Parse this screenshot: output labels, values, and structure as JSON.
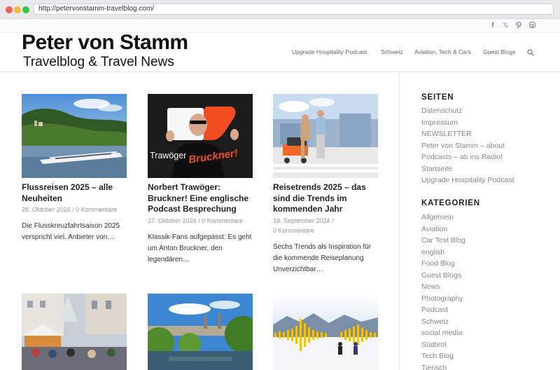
{
  "browser": {
    "url": "http://petervonstamm-travelblog.com/"
  },
  "social": {
    "icons": [
      "facebook-icon",
      "x-twitter-icon",
      "pinterest-icon",
      "instagram-icon"
    ]
  },
  "header": {
    "logo_title": "Peter von Stamm",
    "logo_subtitle": "Travelblog & Travel News",
    "nav": [
      "Upgrade Hospitality Podcast",
      "Schweiz",
      "Aviation, Tech & Cars",
      "Guest Blogs"
    ],
    "search_icon": "search-icon"
  },
  "posts": [
    {
      "title": "Flussreisen 2025 – alle Neuheiten",
      "date": "28. Oktober 2024",
      "separator": " / ",
      "comments": "0 Kommentare",
      "excerpt": "Die Flusskreuzfahrtsaison 2025 verspricht viel. Anbieter von…"
    },
    {
      "title": "Norbert Trawöger: Bruckner! Eine englische Podcast Besprechung",
      "date": "27. Oktober 2024",
      "separator": " / ",
      "comments": "0 Kommentare",
      "excerpt": "Klassik-Fans aufgepasst: Es geht um Anton Bruckner, den legendären…",
      "image_text_1": "Trawöger",
      "image_text_2": "Bruckner!"
    },
    {
      "title": "Reisetrends 2025 – das sind die Trends im kommenden Jahr",
      "date": "19. September 2024",
      "separator": " / ",
      "comments": "0 Kommentare",
      "excerpt": "Sechs Trends als Inspiration für die kommende Reiseplanung Unverzichtbar…"
    }
  ],
  "sidebar": {
    "pages_heading": "SEITEN",
    "pages": [
      "Datenschutz",
      "Impressum",
      "NEWSLETTER",
      "Peter von Stamm – about",
      "Podcasts – ab ins Radio!",
      "Startseite",
      "Upgrade Hospitality Podcast"
    ],
    "categories_heading": "KATEGORIEN",
    "categories": [
      "Allgemein",
      "Aviation",
      "Car Test Blog",
      "english",
      "Food Blog",
      "Guest Blogs",
      "News",
      "Photography",
      "Podcast",
      "Schweiz",
      "social media",
      "Südtirol",
      "Tech Blog",
      "Tierisch"
    ]
  },
  "colors": {
    "accent_orange": "#f05a1e",
    "waveform_yellow": "#f2c20f",
    "sidebar_link": "#888888"
  }
}
